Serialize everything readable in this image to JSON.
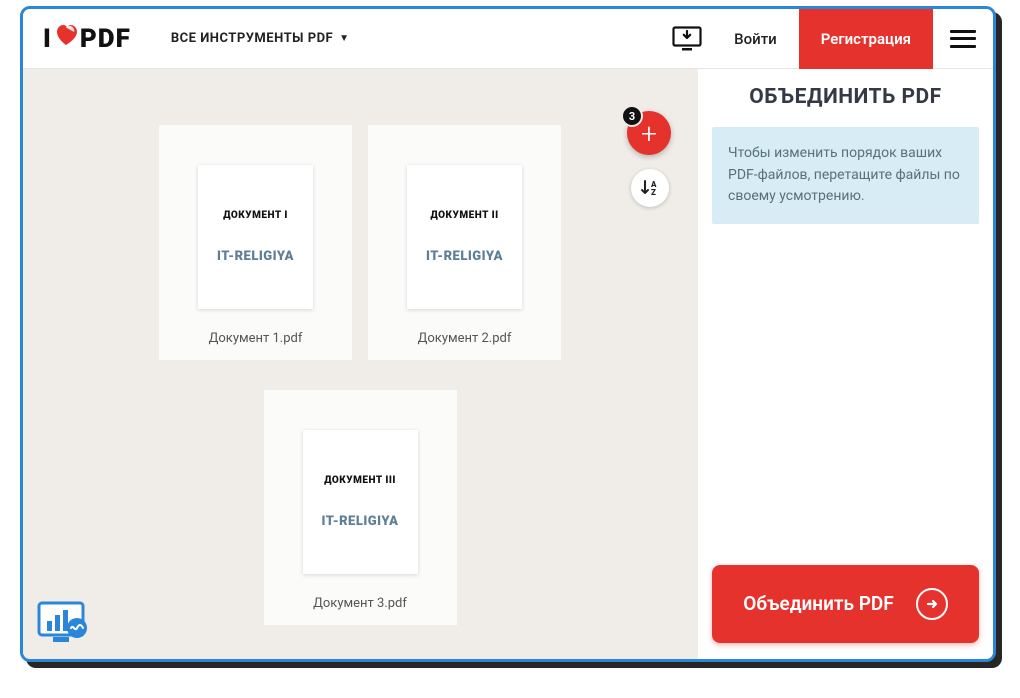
{
  "header": {
    "logo_prefix": "I",
    "logo_suffix": "PDF",
    "tools_label": "ВСЕ ИНСТРУМЕНТЫ PDF",
    "login": "Войти",
    "register": "Регистрация"
  },
  "workspace": {
    "add_badge": "3",
    "sort_label": "↓A Z",
    "files": [
      {
        "doc_label": "ДОКУМЕНТ I",
        "brand": "IT-RELIGIYA",
        "name": "Документ 1.pdf"
      },
      {
        "doc_label": "ДОКУМЕНТ II",
        "brand": "IT-RELIGIYA",
        "name": "Документ 2.pdf"
      },
      {
        "doc_label": "ДОКУМЕНТ III",
        "brand": "IT-RELIGIYA",
        "name": "Документ 3.pdf"
      }
    ]
  },
  "sidebar": {
    "title": "ОБЪЕДИНИТЬ PDF",
    "info": "Чтобы изменить порядок ваших PDF-файлов, перетащите файлы по своему усмотрению.",
    "merge_label": "Объединить PDF"
  }
}
